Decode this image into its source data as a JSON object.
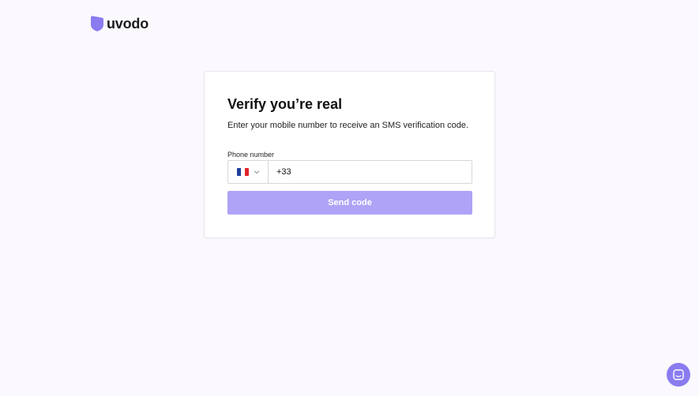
{
  "brand": {
    "name": "uvodo",
    "accent_color": "#8a7cf0",
    "icon": "shield-icon"
  },
  "verify": {
    "title": "Verify you’re real",
    "subtitle": "Enter your mobile number to receive an SMS verification code.",
    "phone_label": "Phone number",
    "country": {
      "selected": "France",
      "flag_icon": "france-flag-icon",
      "flag_colors": [
        "#1f3f9c",
        "#ffffff",
        "#e2242b"
      ],
      "chevron_icon": "chevron-down-icon"
    },
    "phone_value": "+33",
    "send_label": "Send code",
    "send_button_color": "#aea3f6"
  },
  "chat": {
    "icon": "chat-icon"
  }
}
